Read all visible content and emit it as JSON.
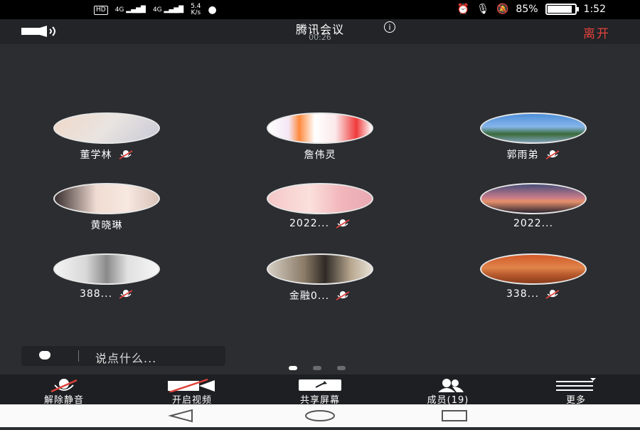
{
  "status_bar": {
    "hd_label": "HD",
    "network_1": "4G",
    "network_2": "4G",
    "speed_value": "5.4",
    "speed_unit": "K/s",
    "battery_percent": "85%",
    "time": "1:52"
  },
  "header": {
    "title": "腾讯会议",
    "timer": "00:26",
    "info_icon": "i",
    "leave_label": "离开"
  },
  "participants": [
    {
      "name": "董学林",
      "muted": true
    },
    {
      "name": "詹伟灵",
      "muted": false
    },
    {
      "name": "郭雨弟",
      "muted": true
    },
    {
      "name": "黄晓琳",
      "muted": false
    },
    {
      "name": "2022...",
      "muted": true
    },
    {
      "name": "2022...",
      "muted": false
    },
    {
      "name": "388...",
      "muted": true
    },
    {
      "name": "金融0...",
      "muted": true
    },
    {
      "name": "338...",
      "muted": true
    }
  ],
  "chat": {
    "placeholder": "说点什么..."
  },
  "toolbar": {
    "unmute": "解除静音",
    "video": "开启视频",
    "share": "共享屏幕",
    "members": "成员(19)",
    "more": "更多"
  },
  "colors": {
    "leave": "#e0423c",
    "background": "#2b2d31"
  }
}
